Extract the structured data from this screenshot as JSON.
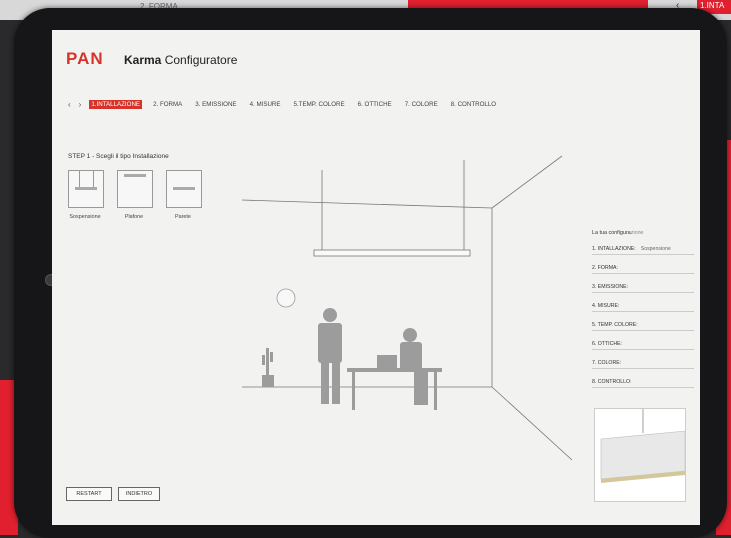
{
  "background": {
    "top_label": "2. FORMA",
    "top_right_label": "1.INTA",
    "top_right_icon": "chevron-left-icon",
    "accent": "#e0202e"
  },
  "header": {
    "logo": "PAN",
    "title_bold": "Karma",
    "title_rest": " Configuratore",
    "brand_color": "#d8332b"
  },
  "nav": {
    "prev_icon": "chevron-left-icon",
    "next_icon": "chevron-right-icon",
    "prev": "‹",
    "next": "›",
    "steps": [
      {
        "label": "1.INTALLAZIONE",
        "active": true
      },
      {
        "label": "2. FORMA",
        "active": false
      },
      {
        "label": "3. EMISSIONE",
        "active": false
      },
      {
        "label": "4. MISURE",
        "active": false
      },
      {
        "label": "5.TEMP. COLORE",
        "active": false
      },
      {
        "label": "6. OTTICHE",
        "active": false
      },
      {
        "label": "7. COLORE",
        "active": false
      },
      {
        "label": "8. CONTROLLO",
        "active": false
      }
    ]
  },
  "step1": {
    "title": "STEP 1 - Scegli il tipo Installazione",
    "options": [
      {
        "label": "Sospensione",
        "icon": "suspension-lamp-icon"
      },
      {
        "label": "Plafone",
        "icon": "ceiling-lamp-icon"
      },
      {
        "label": "Parete",
        "icon": "wall-lamp-icon"
      }
    ]
  },
  "config": {
    "title_bold": "La tua configura",
    "title_rest": "zione",
    "rows": [
      {
        "label": "1. INTALLAZIONE:",
        "value": "Sospensione"
      },
      {
        "label": "2. FORMA:",
        "value": ""
      },
      {
        "label": "3. EMISSIONE:",
        "value": ""
      },
      {
        "label": "4. MISURE:",
        "value": ""
      },
      {
        "label": "5. TEMP. COLORE:",
        "value": ""
      },
      {
        "label": "6. OTTICHE:",
        "value": ""
      },
      {
        "label": "7. COLORE:",
        "value": ""
      },
      {
        "label": "8. CONTROLLO:",
        "value": ""
      }
    ]
  },
  "buttons": {
    "restart": "RESTART",
    "back": "INDIETRO"
  }
}
